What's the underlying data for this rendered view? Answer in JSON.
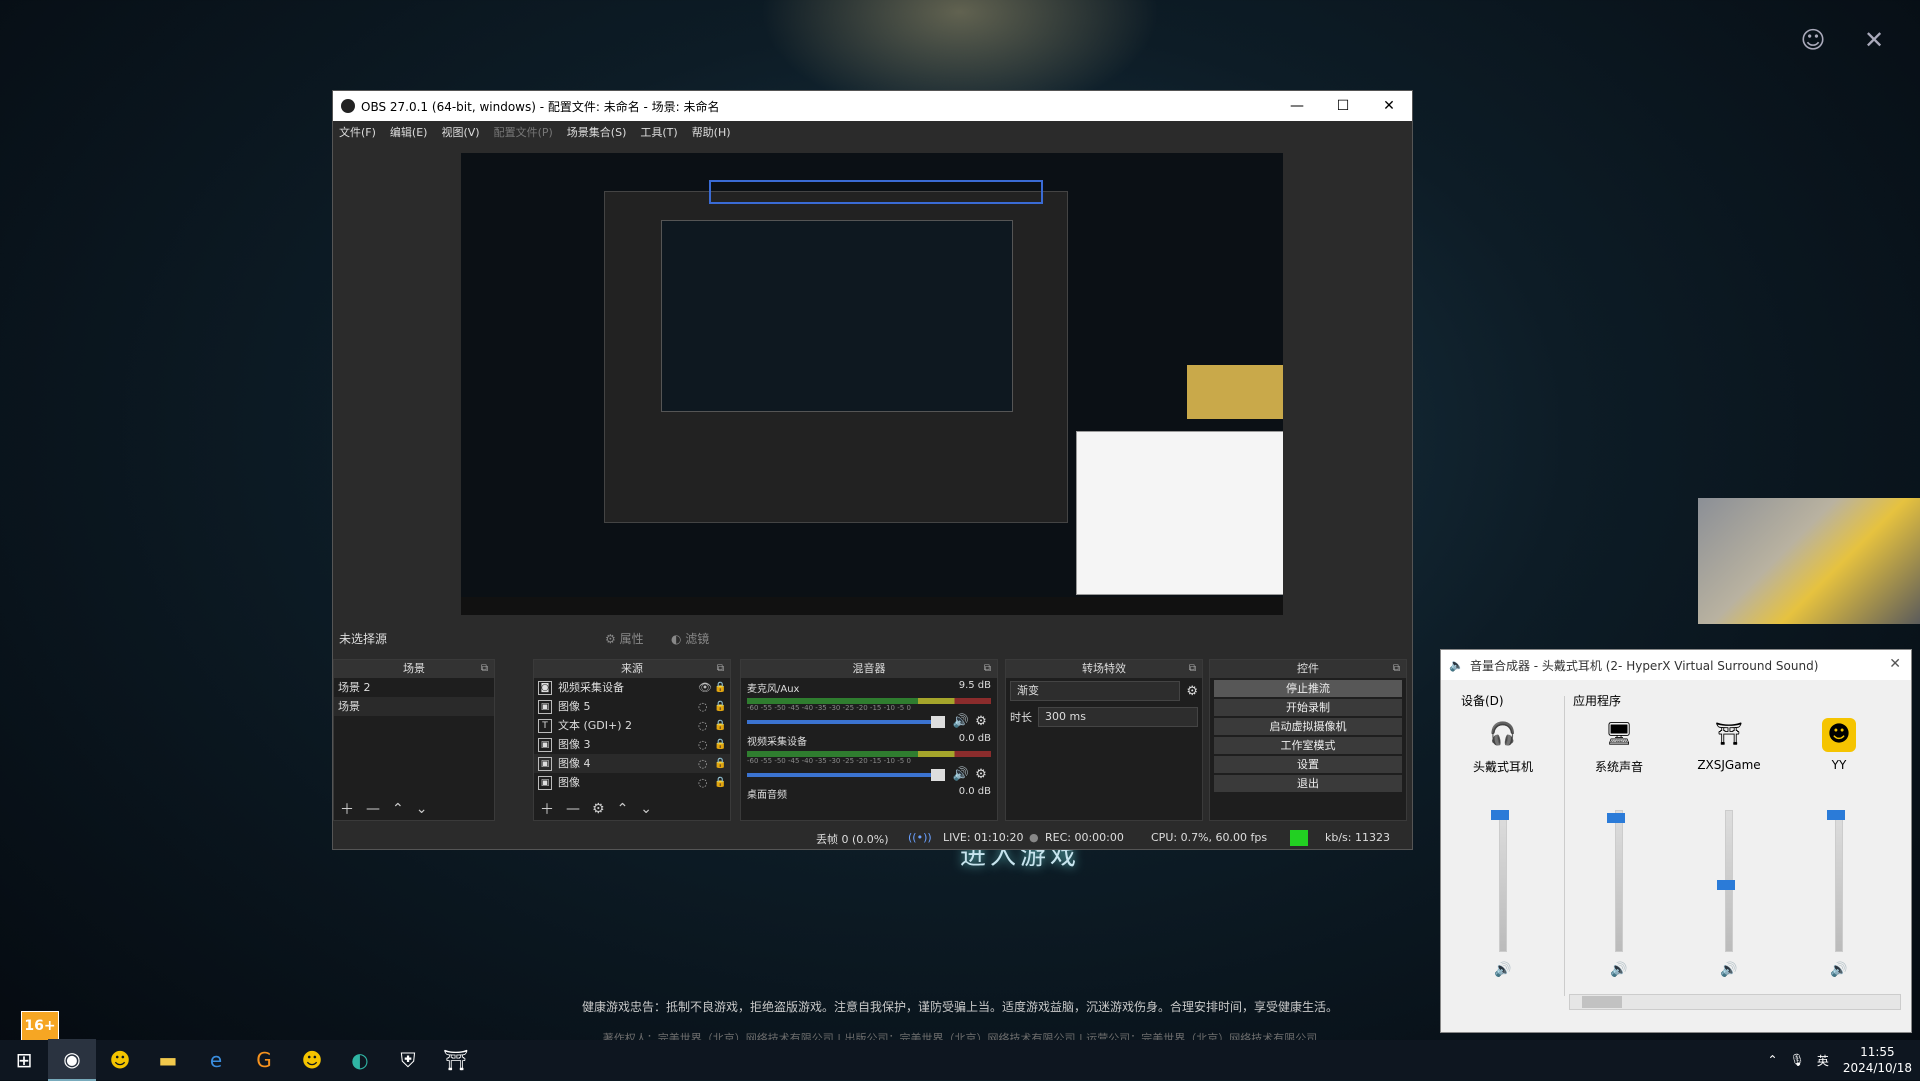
{
  "background": {
    "title": "进入游戏",
    "notice": "健康游戏忠告：抵制不良游戏，拒绝盗版游戏。注意自我保护，谨防受骗上当。适度游戏益脑，沉迷游戏伤身。合理安排时间，享受健康生活。",
    "company": "著作权人：完美世界（北京）网络技术有限公司 | 出版公司：完美世界（北京）网络技术有限公司 | 运营公司：完美世界（北京）网络技术有限公司",
    "age_badge": "16+",
    "overlay_account_icon": "account-icon",
    "overlay_close_glyph": "✕"
  },
  "obs": {
    "title": "OBS 27.0.1 (64-bit, windows) - 配置文件: 未命名 - 场景: 未命名",
    "window_controls": {
      "minimize": "—",
      "maximize": "☐",
      "close": "✕"
    },
    "menu": [
      "文件(F)",
      "编辑(E)",
      "视图(V)",
      "配置文件(P)",
      "场景集合(S)",
      "工具(T)",
      "帮助(H)"
    ],
    "source_bar": {
      "label": "未选择源",
      "properties": "属性",
      "filters": "滤镜"
    },
    "scenes": {
      "header": "场景",
      "items": [
        "场景 2",
        "场景"
      ],
      "selected_index": 1
    },
    "sources": {
      "header": "来源",
      "items": [
        {
          "label": "视频采集设备",
          "icon": "camera-icon",
          "visible": true
        },
        {
          "label": "图像 5",
          "icon": "image-icon",
          "visible": false
        },
        {
          "label": "文本 (GDI+) 2",
          "icon": "text-icon",
          "visible": false
        },
        {
          "label": "图像 3",
          "icon": "image-icon",
          "visible": false
        },
        {
          "label": "图像 4",
          "icon": "image-icon",
          "visible": false
        },
        {
          "label": "图像",
          "icon": "image-icon",
          "visible": false
        }
      ]
    },
    "mixer": {
      "header": "混音器",
      "channels": [
        {
          "name": "麦克风/Aux",
          "db": "9.5 dB"
        },
        {
          "name": "视频采集设备",
          "db": "0.0 dB"
        },
        {
          "name": "桌面音频",
          "db": "0.0 dB"
        }
      ],
      "ticks": "-60 -55 -50 -45 -40 -35 -30 -25 -20 -15 -10 -5 0"
    },
    "transitions": {
      "header": "转场特效",
      "type": "渐变",
      "duration_label": "时长",
      "duration_value": "300 ms"
    },
    "controls": {
      "header": "控件",
      "buttons": [
        "停止推流",
        "开始录制",
        "启动虚拟摄像机",
        "工作室模式",
        "设置",
        "退出"
      ]
    },
    "status": {
      "dropped": "丢帧 0 (0.0%)",
      "live": "LIVE: 01:10:20",
      "rec": "REC: 00:00:00",
      "cpu": "CPU: 0.7%, 60.00 fps",
      "kbps": "kb/s: 11323",
      "status_color": "#22d022"
    }
  },
  "volume_mixer": {
    "title": "音量合成器 - 头戴式耳机 (2- HyperX Virtual Surround Sound)",
    "device_label": "设备(D)",
    "apps_label": "应用程序",
    "channels": [
      {
        "name": "头戴式耳机",
        "icon": "headset-icon",
        "level": 1.0
      },
      {
        "name": "系统声音",
        "icon": "system-sound-icon",
        "level": 0.98
      },
      {
        "name": "ZXSJGame",
        "icon": "game-icon",
        "level": 0.5
      },
      {
        "name": "YY",
        "icon": "yy-icon",
        "level": 1.0
      }
    ],
    "accent": "#2b7bd8"
  },
  "taskbar": {
    "apps": [
      "start-icon",
      "obs-icon",
      "yy-icon",
      "file-explorer-icon",
      "browser-badge-icon",
      "g-app-icon",
      "yy-icon",
      "edge-icon",
      "shield-icon",
      "game-icon"
    ],
    "ime": "英",
    "time": "11:55",
    "date": "2024/10/18"
  }
}
